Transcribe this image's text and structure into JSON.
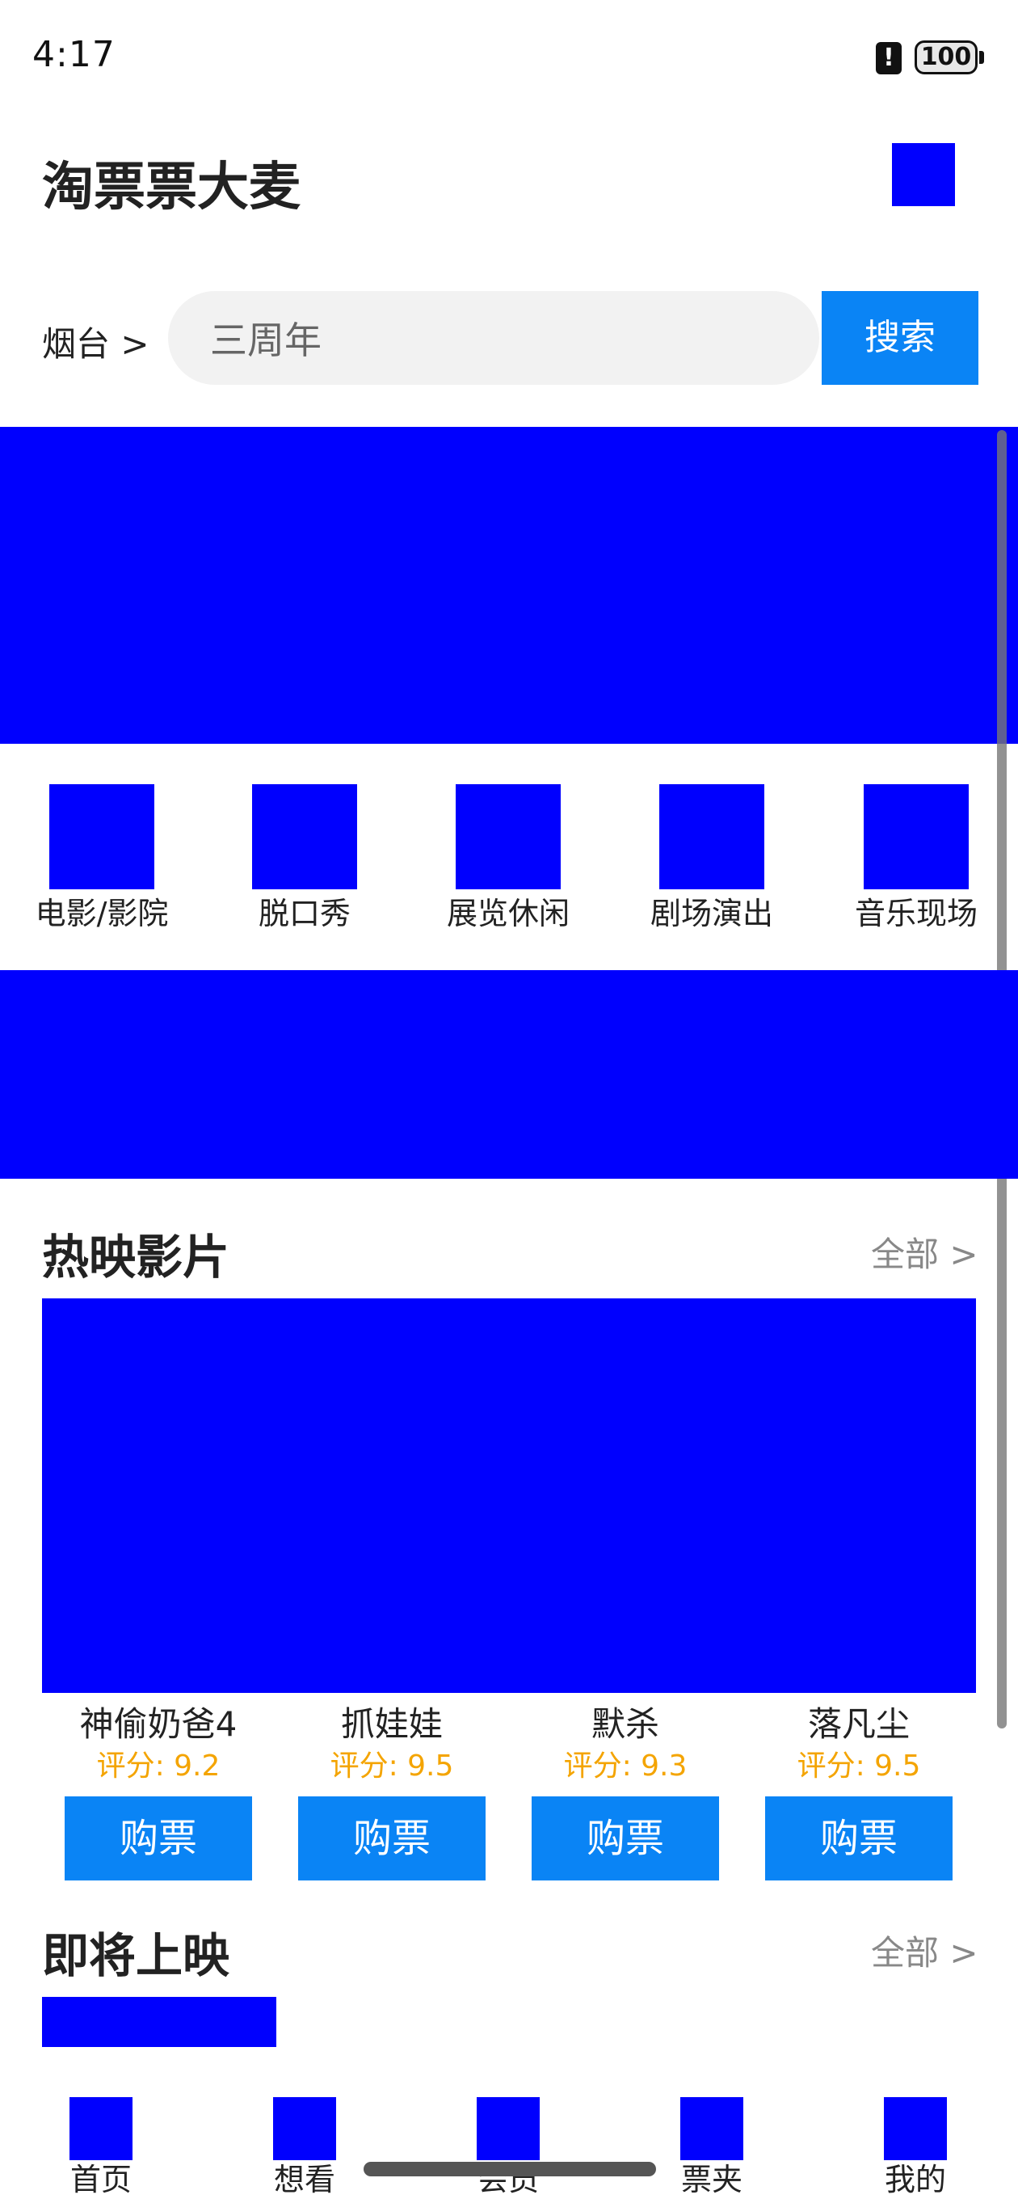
{
  "status_bar": {
    "time": "4:17",
    "alert_glyph": "!",
    "battery": "100"
  },
  "header": {
    "title": "淘票票大麦",
    "icon": "header-image-placeholder"
  },
  "search": {
    "city": "烟台 >",
    "value": "三周年",
    "button": "搜索"
  },
  "categories": [
    {
      "label": "电影/影院"
    },
    {
      "label": "脱口秀"
    },
    {
      "label": "展览休闲"
    },
    {
      "label": "剧场演出"
    },
    {
      "label": "音乐现场"
    }
  ],
  "now_showing": {
    "title": "热映影片",
    "more": "全部 >",
    "movies": [
      {
        "name": "神偷奶爸4",
        "score": "评分: 9.2",
        "buy": "购票"
      },
      {
        "name": "抓娃娃",
        "score": "评分: 9.5",
        "buy": "购票"
      },
      {
        "name": "默杀",
        "score": "评分: 9.3",
        "buy": "购票"
      },
      {
        "name": "落凡尘",
        "score": "评分: 9.5",
        "buy": "购票"
      }
    ]
  },
  "upcoming": {
    "title": "即将上映",
    "more": "全部 >"
  },
  "bottom_nav": [
    {
      "label": "首页"
    },
    {
      "label": "想看"
    },
    {
      "label": "会员"
    },
    {
      "label": "票夹"
    },
    {
      "label": "我的"
    }
  ],
  "colors": {
    "accent": "#0a84f5",
    "placeholder_blue": "#0000fe",
    "score": "#f4a400"
  }
}
